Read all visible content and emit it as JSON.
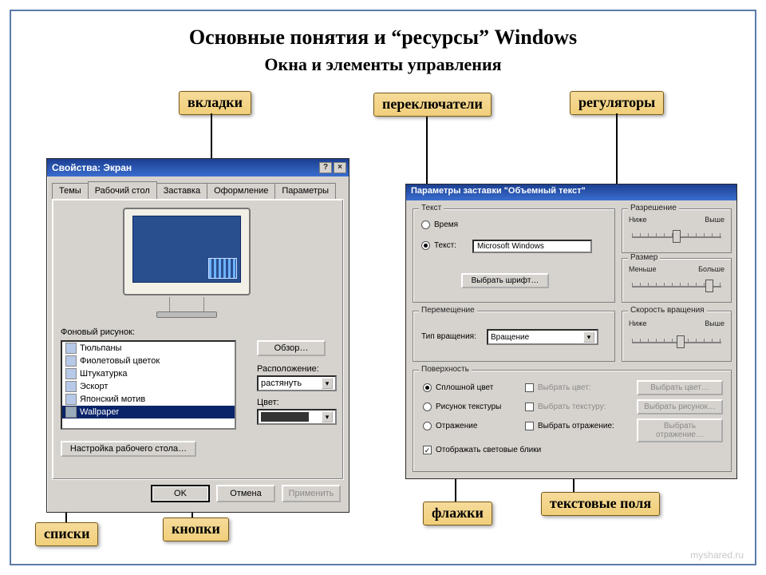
{
  "titles": {
    "main": "Основные понятия   и “ресурсы” Windows",
    "sub": "Окна и элементы управления"
  },
  "callouts": {
    "tabs": "вкладки",
    "radios": "переключатели",
    "sliders": "регуляторы",
    "lists": "списки",
    "buttons": "кнопки",
    "checks": "флажки",
    "textfields": "текстовые поля"
  },
  "dlg1": {
    "title": "Свойства: Экран",
    "help": "?",
    "close": "×",
    "tabs": [
      "Темы",
      "Рабочий стол",
      "Заставка",
      "Оформление",
      "Параметры"
    ],
    "active_tab": 1,
    "bglabel": "Фоновый рисунок:",
    "list": [
      "Тюльпаны",
      "Фиолетовый цветок",
      "Штукатурка",
      "Эскорт",
      "Японский мотив",
      "Wallpaper"
    ],
    "selected": 5,
    "browse": "Обзор…",
    "pos_label": "Расположение:",
    "pos_value": "растянуть",
    "color_label": "Цвет:",
    "desk_settings": "Настройка рабочего стола…",
    "ok": "OK",
    "cancel": "Отмена",
    "apply": "Применить"
  },
  "dlg2": {
    "title": "Параметры заставки \"Объемный текст\"",
    "g_text": "Текст",
    "r_time": "Время",
    "r_text": "Текст:",
    "text_value": "Microsoft Windows",
    "choose_font": "Выбрать шрифт…",
    "g_res": "Разрешение",
    "res_lo": "Ниже",
    "res_hi": "Выше",
    "g_size": "Размер",
    "size_lo": "Меньше",
    "size_hi": "Больше",
    "g_move": "Перемещение",
    "rot_label": "Тип вращения:",
    "rot_value": "Вращение",
    "g_speed": "Скорость вращения",
    "sp_lo": "Ниже",
    "sp_hi": "Выше",
    "g_surface": "Поверхность",
    "r_solid": "Сплошной цвет",
    "r_texture": "Рисунок текстуры",
    "r_reflect": "Отражение",
    "ck_color": "Выбрать цвет:",
    "ck_texture": "Выбрать текстуру:",
    "ck_reflect": "Выбрать отражение:",
    "ck_glare": "Отображать световые блики",
    "btn_color": "Выбрать цвет…",
    "btn_texture": "Выбрать рисунок…",
    "btn_reflect": "Выбрать отражение…"
  },
  "watermark": "myshared.ru"
}
